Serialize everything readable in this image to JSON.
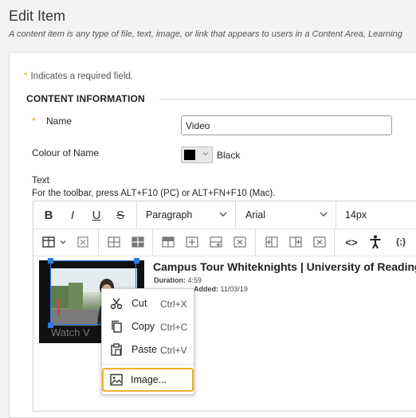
{
  "page": {
    "title": "Edit Item",
    "subtitle": "A content item is any type of file, text, image, or link that appears to users in a Content Area, Learning"
  },
  "form": {
    "required_star": "*",
    "required_note": "Indicates a required field.",
    "section_heading": "CONTENT INFORMATION",
    "name_label": "Name",
    "name_value": "Video",
    "colour_label": "Colour of Name",
    "colour_value": "Black",
    "colour_swatch": "#000000",
    "text_label": "Text",
    "toolbar_help": "For the toolbar, press ALT+F10 (PC) or ALT+FN+F10 (Mac)."
  },
  "toolbar": {
    "bold": "B",
    "italic": "I",
    "underline": "U",
    "strikethrough": "S",
    "paragraph": "Paragraph",
    "font": "Arial",
    "size": "14px",
    "source_code": "<>",
    "embed": "{;}"
  },
  "content": {
    "video_title": "Campus Tour Whiteknights | University of Reading",
    "duration_label": "Duration:",
    "duration_value": "4:59",
    "added_label": "Added:",
    "added_value": "11/03/19",
    "watch_text": "Watch V"
  },
  "context_menu": {
    "cut_label": "Cut",
    "cut_shortcut": "Ctrl+X",
    "copy_label": "Copy",
    "copy_shortcut": "Ctrl+C",
    "paste_label": "Paste",
    "paste_shortcut": "Ctrl+V",
    "image_label": "Image..."
  },
  "colors": {
    "accent_required": "#e0a800",
    "selection": "#2b7de1",
    "highlight": "#f0b030"
  }
}
